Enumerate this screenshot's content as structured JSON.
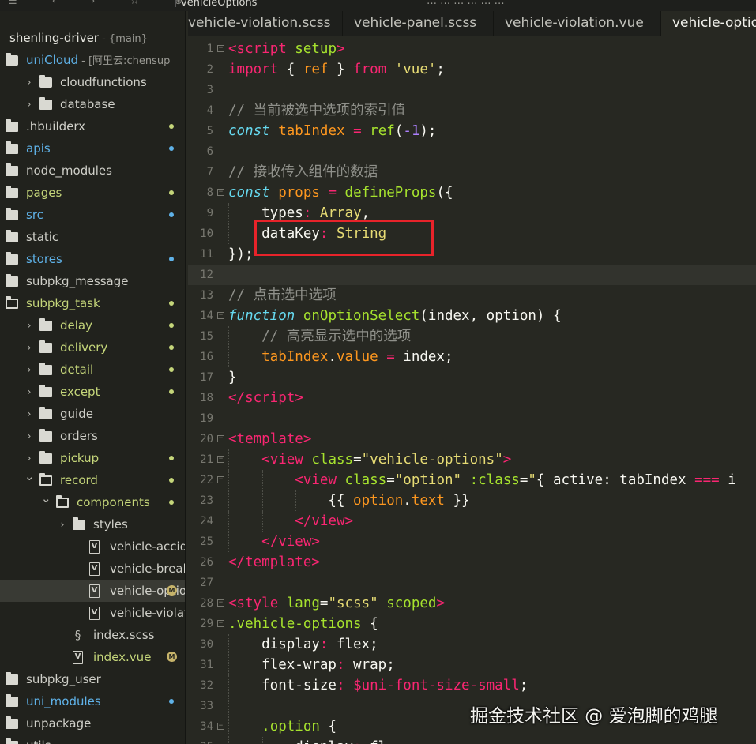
{
  "topbar": {
    "file_title": "vehicleOptions",
    "icons": "☰ ‹ › ☆ ⊕",
    "menu_fragment": "…  …  …  …  …  …"
  },
  "sidebar": {
    "items": [
      {
        "label": "shenling-driver",
        "suffix": " - {main}",
        "depth": 0,
        "icon": "none",
        "chevron": "",
        "style": "bold",
        "dot": ""
      },
      {
        "label": "uniCloud",
        "suffix": " - [阿里云:chensup",
        "depth": 0,
        "icon": "cloud-folder",
        "chevron": "open",
        "style": "blue",
        "dot": ""
      },
      {
        "label": "cloudfunctions",
        "suffix": "",
        "depth": 1,
        "icon": "cloud",
        "chevron": "closed",
        "style": "",
        "dot": ""
      },
      {
        "label": "database",
        "suffix": "",
        "depth": 1,
        "icon": "folder",
        "chevron": "closed",
        "style": "",
        "dot": ""
      },
      {
        "label": ".hbuilderx",
        "suffix": "",
        "depth": 0,
        "icon": "folder",
        "chevron": "",
        "style": "",
        "dot": "#c5d67a"
      },
      {
        "label": "apis",
        "suffix": "",
        "depth": 0,
        "icon": "folder",
        "chevron": "",
        "style": "blue",
        "dot": "#5fb2e8"
      },
      {
        "label": "node_modules",
        "suffix": "",
        "depth": 0,
        "icon": "folder",
        "chevron": "",
        "style": "",
        "dot": ""
      },
      {
        "label": "pages",
        "suffix": "",
        "depth": 0,
        "icon": "folder",
        "chevron": "",
        "style": "green",
        "dot": "#c5d67a"
      },
      {
        "label": "src",
        "suffix": "",
        "depth": 0,
        "icon": "folder",
        "chevron": "",
        "style": "blue",
        "dot": "#5fb2e8"
      },
      {
        "label": "static",
        "suffix": "",
        "depth": 0,
        "icon": "folder",
        "chevron": "",
        "style": "",
        "dot": ""
      },
      {
        "label": "stores",
        "suffix": "",
        "depth": 0,
        "icon": "folder",
        "chevron": "",
        "style": "blue",
        "dot": "#5fb2e8"
      },
      {
        "label": "subpkg_message",
        "suffix": "",
        "depth": 0,
        "icon": "folder",
        "chevron": "",
        "style": "",
        "dot": ""
      },
      {
        "label": "subpkg_task",
        "suffix": "",
        "depth": 0,
        "icon": "folder-open",
        "chevron": "",
        "style": "green",
        "dot": "#c5d67a"
      },
      {
        "label": "delay",
        "suffix": "",
        "depth": 1,
        "icon": "folder",
        "chevron": "closed",
        "style": "green",
        "dot": "#c5d67a"
      },
      {
        "label": "delivery",
        "suffix": "",
        "depth": 1,
        "icon": "folder",
        "chevron": "closed",
        "style": "green",
        "dot": "#c5d67a"
      },
      {
        "label": "detail",
        "suffix": "",
        "depth": 1,
        "icon": "folder",
        "chevron": "closed",
        "style": "green",
        "dot": "#c5d67a"
      },
      {
        "label": "except",
        "suffix": "",
        "depth": 1,
        "icon": "folder",
        "chevron": "closed",
        "style": "green",
        "dot": "#c5d67a"
      },
      {
        "label": "guide",
        "suffix": "",
        "depth": 1,
        "icon": "folder",
        "chevron": "closed",
        "style": "",
        "dot": ""
      },
      {
        "label": "orders",
        "suffix": "",
        "depth": 1,
        "icon": "folder",
        "chevron": "closed",
        "style": "",
        "dot": ""
      },
      {
        "label": "pickup",
        "suffix": "",
        "depth": 1,
        "icon": "folder",
        "chevron": "closed",
        "style": "green",
        "dot": "#c5d67a"
      },
      {
        "label": "record",
        "suffix": "",
        "depth": 1,
        "icon": "folder-open",
        "chevron": "open",
        "style": "green",
        "dot": "#c5d67a"
      },
      {
        "label": "components",
        "suffix": "",
        "depth": 2,
        "icon": "folder-open",
        "chevron": "open",
        "style": "green",
        "dot": "#c5d67a"
      },
      {
        "label": "styles",
        "suffix": "",
        "depth": 3,
        "icon": "folder",
        "chevron": "closed",
        "style": "",
        "dot": ""
      },
      {
        "label": "vehicle-acciden…",
        "suffix": "",
        "depth": 4,
        "icon": "vfile",
        "chevron": "",
        "style": "",
        "dot": ""
      },
      {
        "label": "vehicle-breakd…",
        "suffix": "",
        "depth": 4,
        "icon": "vfile",
        "chevron": "",
        "style": "",
        "dot": ""
      },
      {
        "label": "vehicle-optio…",
        "suffix": "",
        "depth": 4,
        "icon": "vfile",
        "chevron": "",
        "style": "",
        "dot": "",
        "badge": "M",
        "selected": true
      },
      {
        "label": "vehicle-violatio…",
        "suffix": "",
        "depth": 4,
        "icon": "vfile",
        "chevron": "",
        "style": "",
        "dot": ""
      },
      {
        "label": "index.scss",
        "suffix": "",
        "depth": 3,
        "icon": "sfile",
        "chevron": "",
        "style": "",
        "dot": ""
      },
      {
        "label": "index.vue",
        "suffix": "",
        "depth": 3,
        "icon": "vfile",
        "chevron": "",
        "style": "green",
        "dot": "",
        "badge": "M"
      },
      {
        "label": "subpkg_user",
        "suffix": "",
        "depth": 0,
        "icon": "folder",
        "chevron": "",
        "style": "",
        "dot": ""
      },
      {
        "label": "uni_modules",
        "suffix": "",
        "depth": 0,
        "icon": "folder",
        "chevron": "",
        "style": "blue",
        "dot": "#5fb2e8"
      },
      {
        "label": "unpackage",
        "suffix": "",
        "depth": 0,
        "icon": "folder",
        "chevron": "",
        "style": "",
        "dot": ""
      },
      {
        "label": "utils",
        "suffix": "",
        "depth": 0,
        "icon": "folder",
        "chevron": "",
        "style": "",
        "dot": ""
      }
    ]
  },
  "tabs": [
    {
      "label": "vehicle-violation.scss",
      "active": false
    },
    {
      "label": "vehicle-panel.scss",
      "active": false
    },
    {
      "label": "vehicle-violation.vue",
      "active": false
    },
    {
      "label": "vehicle-optio",
      "active": true
    }
  ],
  "editor": {
    "current_line": 12,
    "lines": [
      {
        "n": "1",
        "fold": "⊟",
        "indent": 0,
        "t": [
          [
            "tg",
            "<"
          ],
          [
            "tg",
            "script"
          ],
          [
            "at",
            " setup"
          ],
          [
            "tg",
            ">"
          ]
        ]
      },
      {
        "n": "2",
        "fold": "",
        "indent": 0,
        "t": [
          [
            "kw",
            "import"
          ],
          [
            "p",
            " { "
          ],
          [
            "vr",
            "ref"
          ],
          [
            "p",
            " } "
          ],
          [
            "kw",
            "from"
          ],
          [
            "s",
            " 'vue'"
          ],
          [
            "p",
            ";"
          ]
        ]
      },
      {
        "n": "3",
        "fold": "",
        "indent": 0,
        "t": []
      },
      {
        "n": "4",
        "fold": "",
        "indent": 0,
        "t": [
          [
            "c",
            "// 当前被选中选项的索引值"
          ]
        ]
      },
      {
        "n": "5",
        "fold": "",
        "indent": 0,
        "t": [
          [
            "ty",
            "const"
          ],
          [
            "p",
            " "
          ],
          [
            "or",
            "tabIndex"
          ],
          [
            "kw",
            " ="
          ],
          [
            "p",
            " "
          ],
          [
            "fn",
            "ref"
          ],
          [
            "p",
            "("
          ],
          [
            "n",
            "-1"
          ],
          [
            "p",
            ");"
          ]
        ]
      },
      {
        "n": "6",
        "fold": "",
        "indent": 0,
        "t": []
      },
      {
        "n": "7",
        "fold": "",
        "indent": 0,
        "t": [
          [
            "c",
            "// 接收传入组件的数据"
          ]
        ]
      },
      {
        "n": "8",
        "fold": "⊟",
        "indent": 0,
        "t": [
          [
            "ty",
            "const"
          ],
          [
            "p",
            " "
          ],
          [
            "or",
            "props"
          ],
          [
            "kw",
            " ="
          ],
          [
            "p",
            " "
          ],
          [
            "fn",
            "defineProps"
          ],
          [
            "p",
            "({"
          ]
        ]
      },
      {
        "n": "9",
        "fold": "",
        "indent": 1,
        "t": [
          [
            "p",
            "    types"
          ],
          [
            "kw",
            ":"
          ],
          [
            "p",
            " "
          ],
          [
            "s",
            "Array"
          ],
          [
            "p",
            ","
          ]
        ]
      },
      {
        "n": "10",
        "fold": "",
        "indent": 1,
        "t": [
          [
            "p",
            "    dataKey"
          ],
          [
            "kw",
            ":"
          ],
          [
            "p",
            " "
          ],
          [
            "s",
            "String"
          ]
        ]
      },
      {
        "n": "11",
        "fold": "",
        "indent": 0,
        "t": [
          [
            "p",
            "});"
          ]
        ]
      },
      {
        "n": "12",
        "fold": "",
        "indent": 0,
        "t": []
      },
      {
        "n": "13",
        "fold": "",
        "indent": 0,
        "t": [
          [
            "c",
            "// 点击选中选项"
          ]
        ]
      },
      {
        "n": "14",
        "fold": "⊟",
        "indent": 0,
        "t": [
          [
            "ty",
            "function"
          ],
          [
            "p",
            " "
          ],
          [
            "fn",
            "onOptionSelect"
          ],
          [
            "p",
            "("
          ],
          [
            "p",
            "index"
          ],
          [
            "p",
            ", "
          ],
          [
            "p",
            "option"
          ],
          [
            "p",
            ") {"
          ]
        ]
      },
      {
        "n": "15",
        "fold": "",
        "indent": 1,
        "t": [
          [
            "c",
            "    // 高亮显示选中的选项"
          ]
        ]
      },
      {
        "n": "16",
        "fold": "",
        "indent": 1,
        "t": [
          [
            "or",
            "    tabIndex"
          ],
          [
            "p",
            "."
          ],
          [
            "or",
            "value"
          ],
          [
            "kw",
            " ="
          ],
          [
            "p",
            " index;"
          ]
        ]
      },
      {
        "n": "17",
        "fold": "",
        "indent": 0,
        "t": [
          [
            "p",
            "}"
          ]
        ]
      },
      {
        "n": "18",
        "fold": "",
        "indent": 0,
        "t": [
          [
            "tg",
            "</"
          ],
          [
            "tg",
            "script"
          ],
          [
            "tg",
            ">"
          ]
        ]
      },
      {
        "n": "19",
        "fold": "",
        "indent": 0,
        "t": []
      },
      {
        "n": "20",
        "fold": "⊟",
        "indent": 0,
        "t": [
          [
            "tg",
            "<"
          ],
          [
            "tg",
            "template"
          ],
          [
            "tg",
            ">"
          ]
        ]
      },
      {
        "n": "21",
        "fold": "⊟",
        "indent": 1,
        "t": [
          [
            "p",
            "    "
          ],
          [
            "tg",
            "<"
          ],
          [
            "tg",
            "view"
          ],
          [
            "at",
            " class"
          ],
          [
            "p",
            "="
          ],
          [
            "s",
            "\"vehicle-options\""
          ],
          [
            "tg",
            ">"
          ]
        ]
      },
      {
        "n": "22",
        "fold": "⊟",
        "indent": 2,
        "t": [
          [
            "p",
            "        "
          ],
          [
            "tg",
            "<"
          ],
          [
            "tg",
            "view"
          ],
          [
            "at",
            " class"
          ],
          [
            "p",
            "="
          ],
          [
            "s",
            "\"option\""
          ],
          [
            "at",
            " :class"
          ],
          [
            "p",
            "="
          ],
          [
            "s",
            "\""
          ],
          [
            "p",
            "{ active: tabIndex "
          ],
          [
            "kw",
            "==="
          ],
          [
            "p",
            " i"
          ]
        ]
      },
      {
        "n": "23",
        "fold": "",
        "indent": 3,
        "t": [
          [
            "p",
            "            {{ "
          ],
          [
            "or",
            "option"
          ],
          [
            "p",
            "."
          ],
          [
            "or",
            "text"
          ],
          [
            "p",
            " }}"
          ]
        ]
      },
      {
        "n": "24",
        "fold": "",
        "indent": 2,
        "t": [
          [
            "p",
            "        "
          ],
          [
            "tg",
            "</"
          ],
          [
            "tg",
            "view"
          ],
          [
            "tg",
            ">"
          ]
        ]
      },
      {
        "n": "25",
        "fold": "",
        "indent": 1,
        "t": [
          [
            "p",
            "    "
          ],
          [
            "tg",
            "</"
          ],
          [
            "tg",
            "view"
          ],
          [
            "tg",
            ">"
          ]
        ]
      },
      {
        "n": "26",
        "fold": "",
        "indent": 0,
        "t": [
          [
            "tg",
            "</"
          ],
          [
            "tg",
            "template"
          ],
          [
            "tg",
            ">"
          ]
        ]
      },
      {
        "n": "27",
        "fold": "",
        "indent": 0,
        "t": []
      },
      {
        "n": "28",
        "fold": "⊟",
        "indent": 0,
        "t": [
          [
            "tg",
            "<"
          ],
          [
            "tg",
            "style"
          ],
          [
            "at",
            " lang"
          ],
          [
            "p",
            "="
          ],
          [
            "s",
            "\"scss\""
          ],
          [
            "at",
            " scoped"
          ],
          [
            "tg",
            ">"
          ]
        ]
      },
      {
        "n": "29",
        "fold": "⊟",
        "indent": 0,
        "t": [
          [
            "fn",
            ".vehicle-options"
          ],
          [
            "p",
            " {"
          ]
        ]
      },
      {
        "n": "30",
        "fold": "",
        "indent": 1,
        "t": [
          [
            "p",
            "    display"
          ],
          [
            "kw",
            ":"
          ],
          [
            "p",
            " flex;"
          ]
        ]
      },
      {
        "n": "31",
        "fold": "",
        "indent": 1,
        "t": [
          [
            "p",
            "    flex-wrap"
          ],
          [
            "kw",
            ":"
          ],
          [
            "p",
            " wrap;"
          ]
        ]
      },
      {
        "n": "32",
        "fold": "",
        "indent": 1,
        "t": [
          [
            "p",
            "    font-size"
          ],
          [
            "kw",
            ":"
          ],
          [
            "p",
            " "
          ],
          [
            "kw",
            "$uni-font-size-small"
          ],
          [
            "p",
            ";"
          ]
        ]
      },
      {
        "n": "33",
        "fold": "",
        "indent": 1,
        "t": []
      },
      {
        "n": "34",
        "fold": "⊟",
        "indent": 1,
        "t": [
          [
            "p",
            "    "
          ],
          [
            "fn",
            ".option"
          ],
          [
            "p",
            " {"
          ]
        ]
      },
      {
        "n": "35",
        "fold": "",
        "indent": 2,
        "t": [
          [
            "p",
            "        display"
          ],
          [
            "kw",
            ":"
          ],
          [
            "p",
            " fl"
          ]
        ]
      }
    ]
  },
  "watermark": "掘金技术社区 @ 爱泡脚的鸡腿",
  "colors": {
    "editor_bg": "#272822",
    "sidebar_bg": "#21221d",
    "highlight_box": "#e8232a",
    "folder_green": "#c5d67a",
    "folder_blue": "#5fb2e8"
  }
}
